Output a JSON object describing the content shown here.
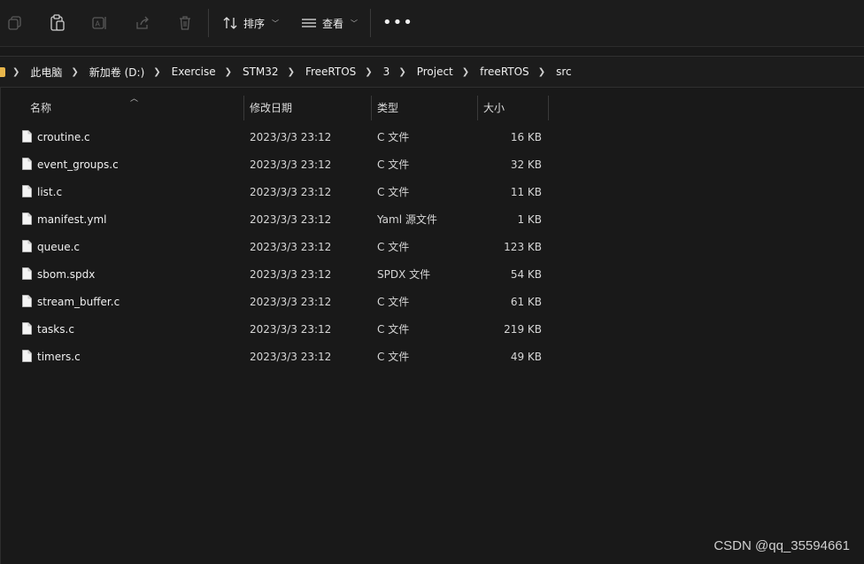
{
  "toolbar": {
    "sort_label": "排序",
    "view_label": "查看",
    "more_label": "•••"
  },
  "breadcrumb": {
    "items": [
      "此电脑",
      "新加卷 (D:)",
      "Exercise",
      "STM32",
      "FreeRTOS",
      "3",
      "Project",
      "freeRTOS",
      "src"
    ]
  },
  "columns": {
    "name": "名称",
    "date": "修改日期",
    "type": "类型",
    "size": "大小"
  },
  "files": [
    {
      "name": "croutine.c",
      "date": "2023/3/3 23:12",
      "type": "C 文件",
      "size": "16 KB"
    },
    {
      "name": "event_groups.c",
      "date": "2023/3/3 23:12",
      "type": "C 文件",
      "size": "32 KB"
    },
    {
      "name": "list.c",
      "date": "2023/3/3 23:12",
      "type": "C 文件",
      "size": "11 KB"
    },
    {
      "name": "manifest.yml",
      "date": "2023/3/3 23:12",
      "type": "Yaml 源文件",
      "size": "1 KB"
    },
    {
      "name": "queue.c",
      "date": "2023/3/3 23:12",
      "type": "C 文件",
      "size": "123 KB"
    },
    {
      "name": "sbom.spdx",
      "date": "2023/3/3 23:12",
      "type": "SPDX 文件",
      "size": "54 KB"
    },
    {
      "name": "stream_buffer.c",
      "date": "2023/3/3 23:12",
      "type": "C 文件",
      "size": "61 KB"
    },
    {
      "name": "tasks.c",
      "date": "2023/3/3 23:12",
      "type": "C 文件",
      "size": "219 KB"
    },
    {
      "name": "timers.c",
      "date": "2023/3/3 23:12",
      "type": "C 文件",
      "size": "49 KB"
    }
  ],
  "watermark": "CSDN @qq_35594661",
  "icons": {
    "toolbar": [
      "copy-icon",
      "paste-icon",
      "rename-icon",
      "share-icon",
      "delete-icon",
      "sort-icon",
      "view-icon",
      "more-icon"
    ],
    "file": "file-icon"
  },
  "colors": {
    "background": "#191919",
    "text": "#e6e6e6",
    "folder": "#e8b64b"
  }
}
